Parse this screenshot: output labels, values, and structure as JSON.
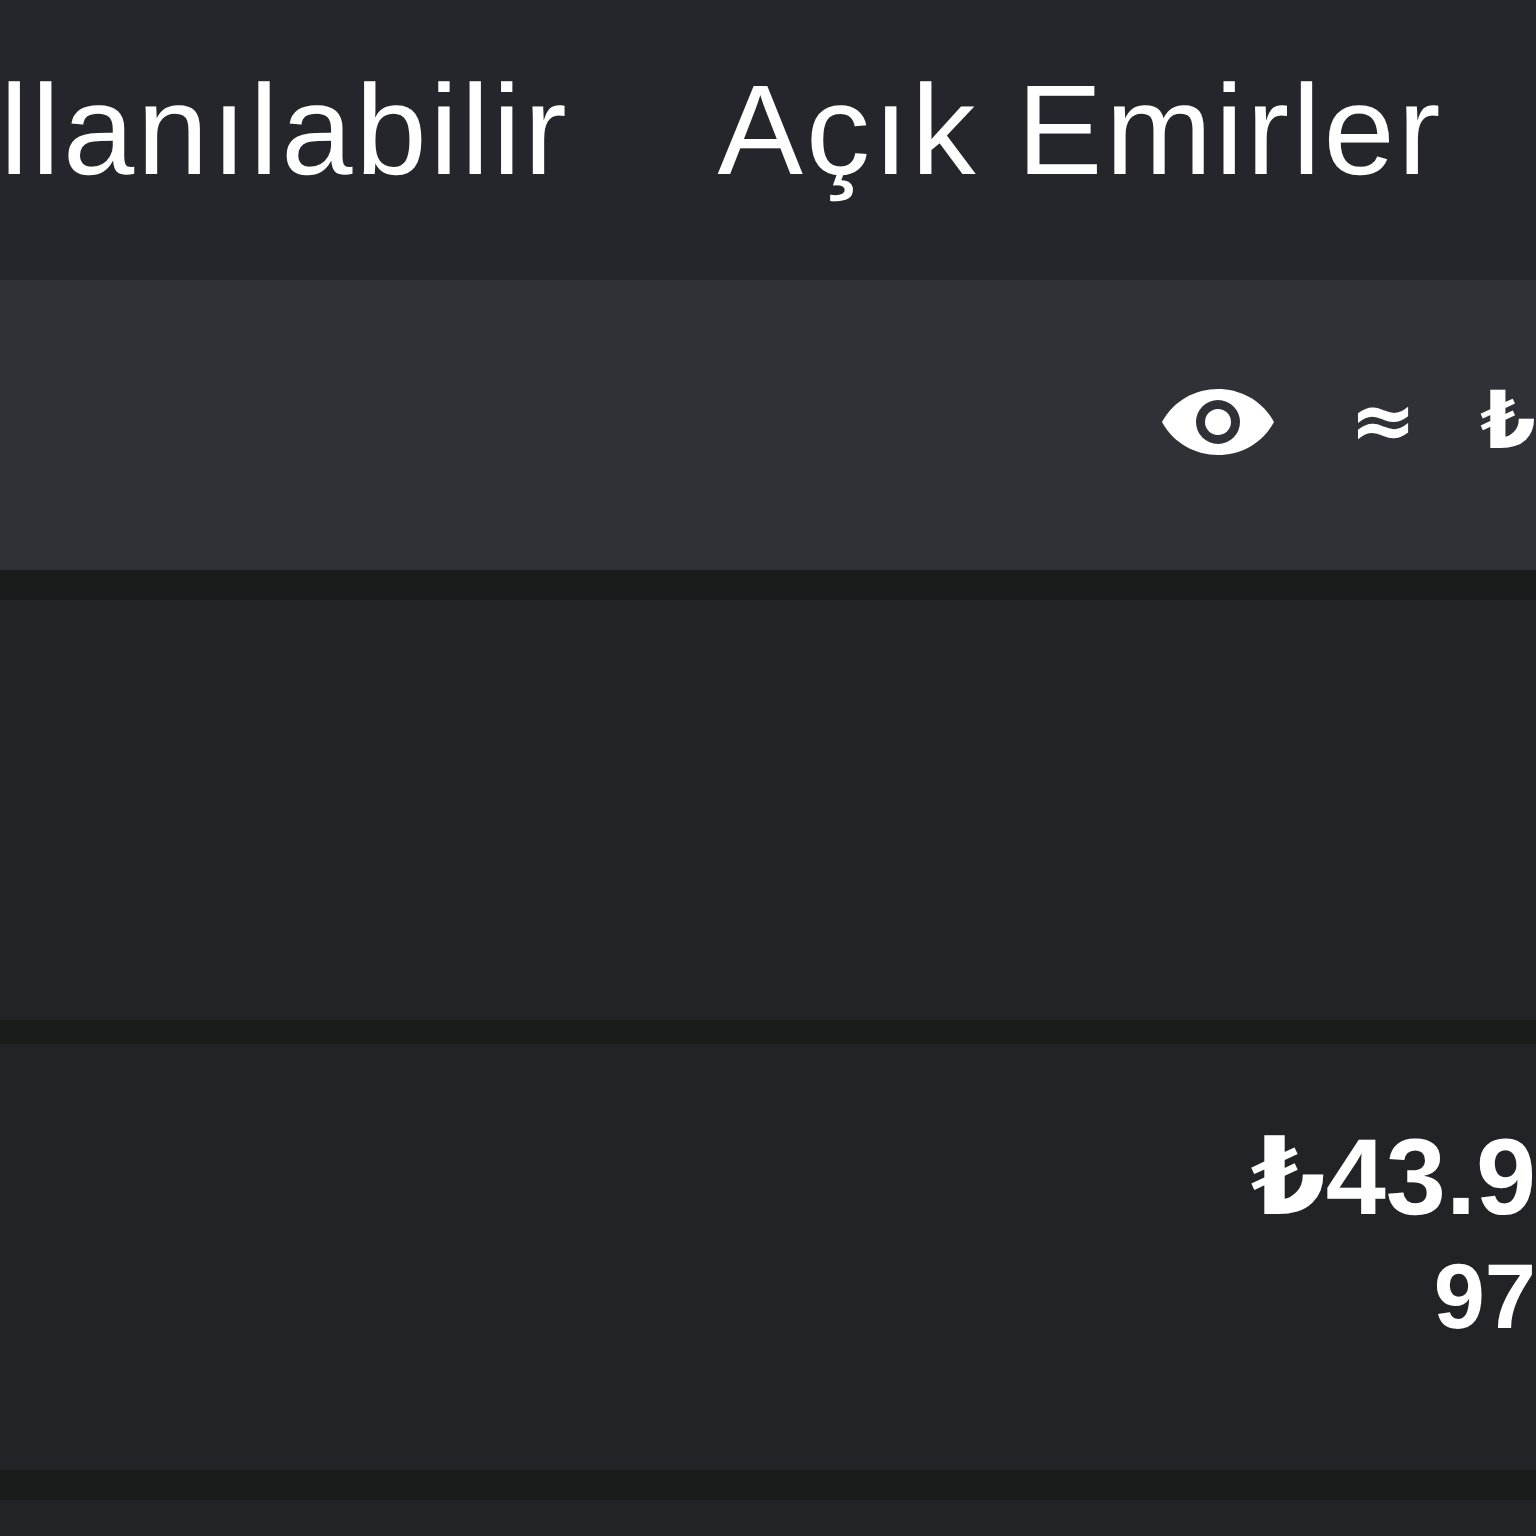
{
  "tabs": [
    {
      "label": "llanılabilir"
    },
    {
      "label": "Açık Emirler"
    }
  ],
  "balance_bar": {
    "approx_total": "≈ ₺"
  },
  "cards": [
    {
      "kind": "blank"
    },
    {
      "kind": "asset",
      "value": "₺43.9",
      "amount": "97"
    },
    {
      "kind": "blank"
    }
  ]
}
